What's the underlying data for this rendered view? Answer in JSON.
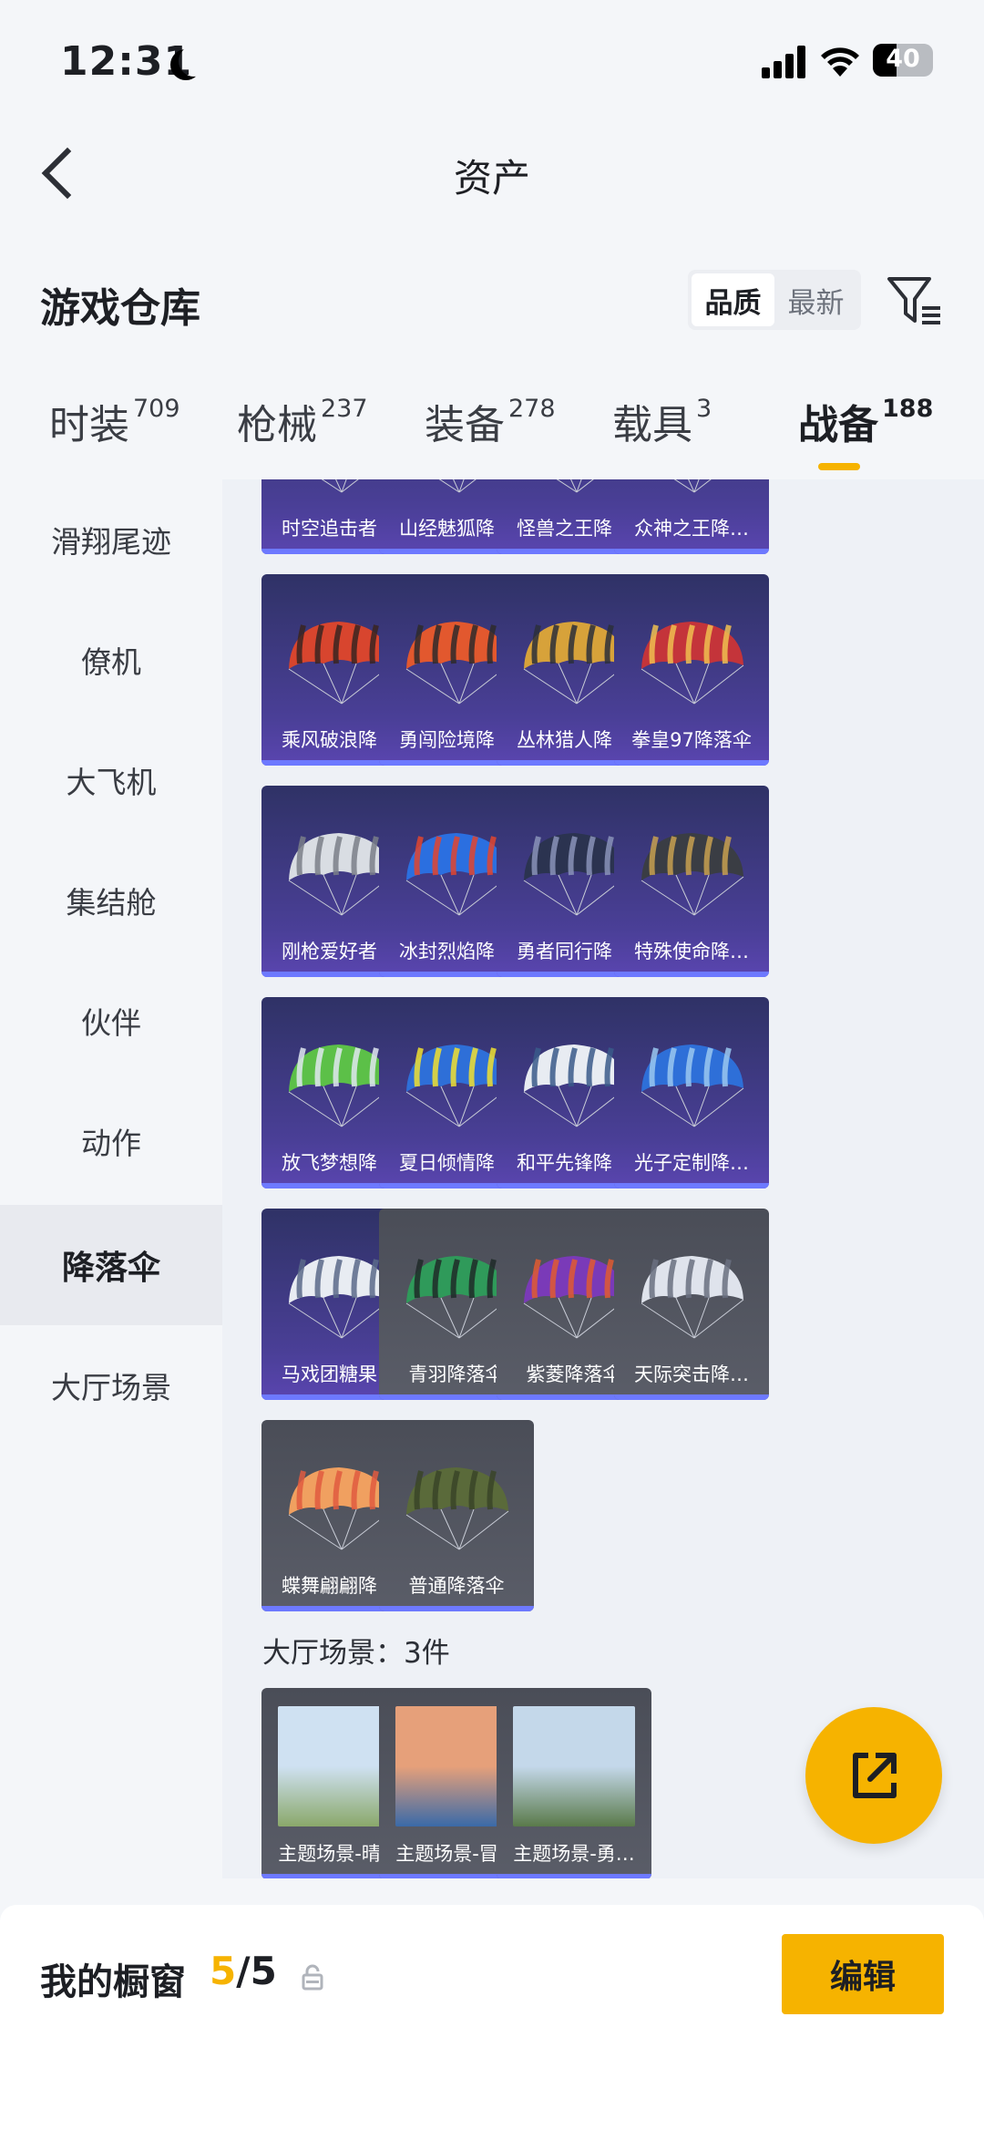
{
  "status": {
    "time": "12:31",
    "battery": "40",
    "battery_level": 0.4
  },
  "header": {
    "title": "资产"
  },
  "warehouse": {
    "title": "游戏仓库",
    "sort_options": [
      "品质",
      "最新"
    ],
    "active_sort": "品质"
  },
  "tabs": [
    {
      "label": "时装",
      "count": "709"
    },
    {
      "label": "枪械",
      "count": "237"
    },
    {
      "label": "装备",
      "count": "278"
    },
    {
      "label": "载具",
      "count": "3"
    },
    {
      "label": "战备",
      "count": "188",
      "active": true
    }
  ],
  "sidebar": [
    {
      "label": "滑翔尾迹"
    },
    {
      "label": "僚机"
    },
    {
      "label": "大飞机"
    },
    {
      "label": "集结舱"
    },
    {
      "label": "伙伴"
    },
    {
      "label": "动作"
    },
    {
      "label": "降落伞",
      "active": true
    },
    {
      "label": "大厅场景"
    }
  ],
  "parachutes": [
    {
      "label": "时空追击者…",
      "tier": "premium",
      "colors": [
        "#c9433a",
        "#f0d18a"
      ]
    },
    {
      "label": "山经魅狐降…",
      "tier": "premium",
      "colors": [
        "#b94a3e",
        "#e8c8a0"
      ]
    },
    {
      "label": "怪兽之王降…",
      "tier": "premium",
      "colors": [
        "#3a3a3a",
        "#c04040"
      ]
    },
    {
      "label": "众神之王降…",
      "tier": "premium",
      "colors": [
        "#e8a93a",
        "#7a4a20"
      ]
    },
    {
      "label": "乘风破浪降…",
      "tier": "premium",
      "colors": [
        "#d8452e",
        "#3a2420"
      ]
    },
    {
      "label": "勇闯险境降…",
      "tier": "premium",
      "colors": [
        "#e2582e",
        "#2e2a2a"
      ]
    },
    {
      "label": "丛林猎人降…",
      "tier": "premium",
      "colors": [
        "#d7a23a",
        "#2b2f3a"
      ]
    },
    {
      "label": "拳皇97降落伞",
      "tier": "premium",
      "colors": [
        "#c4343a",
        "#f0c050"
      ]
    },
    {
      "label": "刚枪爱好者…",
      "tier": "premium",
      "colors": [
        "#d9dde3",
        "#7a7f88"
      ]
    },
    {
      "label": "冰封烈焰降…",
      "tier": "premium",
      "colors": [
        "#2b6fe0",
        "#e2452e"
      ]
    },
    {
      "label": "勇者同行降…",
      "tier": "premium",
      "colors": [
        "#2b3350",
        "#8a93b8"
      ]
    },
    {
      "label": "特殊使命降…",
      "tier": "premium",
      "colors": [
        "#3a3d44",
        "#c8a050"
      ]
    },
    {
      "label": "放飞梦想降…",
      "tier": "premium",
      "colors": [
        "#5cc048",
        "#dfe8f0"
      ]
    },
    {
      "label": "夏日倾情降…",
      "tier": "premium",
      "colors": [
        "#2e6fd8",
        "#f0e030"
      ]
    },
    {
      "label": "和平先锋降…",
      "tier": "premium",
      "colors": [
        "#e8ecf2",
        "#3a5a8a"
      ]
    },
    {
      "label": "光子定制降…",
      "tier": "premium",
      "colors": [
        "#2e6fd8",
        "#9ac8f0"
      ]
    },
    {
      "label": "马戏团糖果…",
      "tier": "premium",
      "colors": [
        "#e8ecf2",
        "#5a6a8a"
      ]
    },
    {
      "label": "青羽降落伞",
      "tier": "plain",
      "colors": [
        "#2f9a5a",
        "#1e2a28"
      ]
    },
    {
      "label": "紫菱降落伞",
      "tier": "plain",
      "colors": [
        "#7a3ab8",
        "#e05a30"
      ]
    },
    {
      "label": "天际突击降…",
      "tier": "plain",
      "colors": [
        "#dfe3ec",
        "#6a7080"
      ]
    },
    {
      "label": "蝶舞翩翩降…",
      "tier": "plain",
      "colors": [
        "#f0a060",
        "#e05a40"
      ]
    },
    {
      "label": "普通降落伞",
      "tier": "plain",
      "colors": [
        "#5a6a3a",
        "#3a4428"
      ]
    }
  ],
  "scenes": {
    "heading": "大厅场景：3件",
    "items": [
      {
        "label": "主题场景-晴…",
        "colors": [
          "#cfe1f2",
          "#8aa86a"
        ]
      },
      {
        "label": "主题场景-冒…",
        "colors": [
          "#e6a07a",
          "#3a6aa8"
        ]
      },
      {
        "label": "主题场景-勇…",
        "colors": [
          "#c4d8ea",
          "#5a7a4a"
        ]
      }
    ]
  },
  "window": {
    "title": "我的橱窗",
    "current": "5",
    "total": "5",
    "edit_label": "编辑"
  }
}
